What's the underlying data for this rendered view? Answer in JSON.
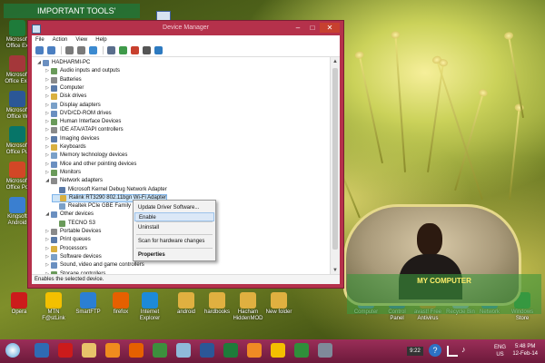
{
  "desktop": {
    "tools_banner": "IMPORTANT TOOLS'",
    "left_icons": [
      {
        "label": "Microsoft Office Ex",
        "icon": "excel-icon",
        "color": "#1e7b3a"
      },
      {
        "label": "Microsoft Office Exc",
        "icon": "access-icon",
        "color": "#a4373a"
      },
      {
        "label": "Microsoft Office W",
        "icon": "word-icon",
        "color": "#2b5797"
      },
      {
        "label": "Microsoft Office Pu",
        "icon": "publisher-icon",
        "color": "#077568"
      },
      {
        "label": "Microsoft Office Po",
        "icon": "powerpoint-icon",
        "color": "#d24726"
      },
      {
        "label": "Kingsoft Android",
        "icon": "kingsoft-icon",
        "color": "#3a7fd0"
      }
    ],
    "bottom_icons": [
      {
        "label": "Opera",
        "icon": "opera-icon",
        "color": "#cc1b1b"
      },
      {
        "label": "MTN F@stLink",
        "icon": "mtn-icon",
        "color": "#f3c000"
      },
      {
        "label": "SmartFTP",
        "icon": "smartftp-icon",
        "color": "#2b7fd3"
      },
      {
        "label": "firefox",
        "icon": "firefox-icon",
        "color": "#e66000"
      },
      {
        "label": "Internet Explorer",
        "icon": "ie-icon",
        "color": "#1d8ad8"
      },
      {
        "label": "android",
        "icon": "folder-icon",
        "color": "#e0b040"
      },
      {
        "label": "hardbooks",
        "icon": "folder-icon",
        "color": "#e0b040"
      },
      {
        "label": "Hacham HiddenMOD",
        "icon": "folder-icon",
        "color": "#e0b040"
      },
      {
        "label": "New folder",
        "icon": "folder-icon",
        "color": "#e0b040"
      }
    ],
    "right_icons": [
      {
        "label": "Computer",
        "icon": "computer-icon",
        "color": "#5a8fd0"
      },
      {
        "label": "Control Panel",
        "icon": "control-panel-icon",
        "color": "#3a78c8"
      },
      {
        "label": "avast! Free Antivirus",
        "icon": "avast-icon",
        "color": "#f08a24"
      },
      {
        "label": "Recycle Bin",
        "icon": "recycle-bin-icon",
        "color": "#a0b8d0"
      },
      {
        "label": "Network",
        "icon": "network-icon",
        "color": "#3f8fc0"
      },
      {
        "label": "Windows Store",
        "icon": "store-icon",
        "color": "#2d9b46"
      }
    ],
    "mycomputer_label": "MY COMPUTER"
  },
  "window": {
    "title": "Device Manager",
    "menu": [
      "File",
      "Action",
      "View",
      "Help"
    ],
    "toolbar_icons": [
      "back-icon",
      "forward-icon",
      "properties-icon",
      "refresh-icon",
      "help-icon",
      "display-icon",
      "update-driver-icon",
      "uninstall-icon",
      "disable-icon",
      "scan-icon"
    ],
    "tree": [
      {
        "label": "HADHARMI-PC",
        "level": 0,
        "arrow": "◢"
      },
      {
        "label": "Audio inputs and outputs",
        "level": 1,
        "arrow": "▷"
      },
      {
        "label": "Batteries",
        "level": 1,
        "arrow": "▷"
      },
      {
        "label": "Computer",
        "level": 1,
        "arrow": "▷"
      },
      {
        "label": "Disk drives",
        "level": 1,
        "arrow": "▷"
      },
      {
        "label": "Display adapters",
        "level": 1,
        "arrow": "▷"
      },
      {
        "label": "DVD/CD-ROM drives",
        "level": 1,
        "arrow": "▷"
      },
      {
        "label": "Human Interface Devices",
        "level": 1,
        "arrow": "▷"
      },
      {
        "label": "IDE ATA/ATAPI controllers",
        "level": 1,
        "arrow": "▷"
      },
      {
        "label": "Imaging devices",
        "level": 1,
        "arrow": "▷"
      },
      {
        "label": "Keyboards",
        "level": 1,
        "arrow": "▷"
      },
      {
        "label": "Memory technology devices",
        "level": 1,
        "arrow": "▷"
      },
      {
        "label": "Mice and other pointing devices",
        "level": 1,
        "arrow": "▷"
      },
      {
        "label": "Monitors",
        "level": 1,
        "arrow": "▷"
      },
      {
        "label": "Network adapters",
        "level": 1,
        "arrow": "◢"
      },
      {
        "label": "Microsoft Kernel Debug Network Adapter",
        "level": 2,
        "arrow": ""
      },
      {
        "label": "Ralink RT3290 802.11bgn Wi-Fi Adapter",
        "level": 2,
        "arrow": "",
        "selected": true
      },
      {
        "label": "Realtek PCIe GBE Family Controller",
        "level": 2,
        "arrow": ""
      },
      {
        "label": "Other devices",
        "level": 1,
        "arrow": "◢"
      },
      {
        "label": "TECNO S3",
        "level": 2,
        "arrow": ""
      },
      {
        "label": "Portable Devices",
        "level": 1,
        "arrow": "▷"
      },
      {
        "label": "Print queues",
        "level": 1,
        "arrow": "▷"
      },
      {
        "label": "Processors",
        "level": 1,
        "arrow": "▷"
      },
      {
        "label": "Software devices",
        "level": 1,
        "arrow": "▷"
      },
      {
        "label": "Sound, video and game controllers",
        "level": 1,
        "arrow": "▷"
      },
      {
        "label": "Storage controllers",
        "level": 1,
        "arrow": "▷"
      }
    ],
    "status": "Enables the selected device."
  },
  "context_menu": {
    "items": [
      {
        "label": "Update Driver Software...",
        "hot": false,
        "bold": false
      },
      {
        "label": "Enable",
        "hot": true,
        "bold": false
      },
      {
        "label": "Uninstall",
        "hot": false,
        "bold": false
      },
      {
        "label": "Scan for hardware changes",
        "hot": false,
        "bold": false
      },
      {
        "label": "Properties",
        "hot": false,
        "bold": true
      }
    ]
  },
  "taskbar": {
    "pinned": [
      {
        "icon": "windows-media-icon",
        "color": "#2f6bb3"
      },
      {
        "icon": "opera-icon",
        "color": "#cc1b1b"
      },
      {
        "icon": "file-explorer-icon",
        "color": "#e8c36a"
      },
      {
        "icon": "media-player-icon",
        "color": "#f08c1e"
      },
      {
        "icon": "firefox-icon",
        "color": "#e66000"
      },
      {
        "icon": "media-center-icon",
        "color": "#3d8f3d"
      },
      {
        "icon": "notepad-icon",
        "color": "#8fbad9"
      },
      {
        "icon": "word-icon",
        "color": "#2b5797"
      },
      {
        "icon": "excel-icon",
        "color": "#1e7b3a"
      },
      {
        "icon": "vlc-icon",
        "color": "#f08a24"
      },
      {
        "icon": "ms-pes-icon",
        "color": "#f3c000"
      },
      {
        "icon": "chrome-icon",
        "color": "#2f8f3a"
      },
      {
        "icon": "device-manager-icon",
        "color": "#7f8a9a"
      }
    ],
    "tray_text": "9:22",
    "language": "ENG",
    "region": "US",
    "time": "5:48 PM",
    "date": "12-Feb-14"
  },
  "colors": {
    "accent": "#b5314b",
    "taskbar_top": "#9b2e58",
    "selection": "#cde4f7"
  }
}
